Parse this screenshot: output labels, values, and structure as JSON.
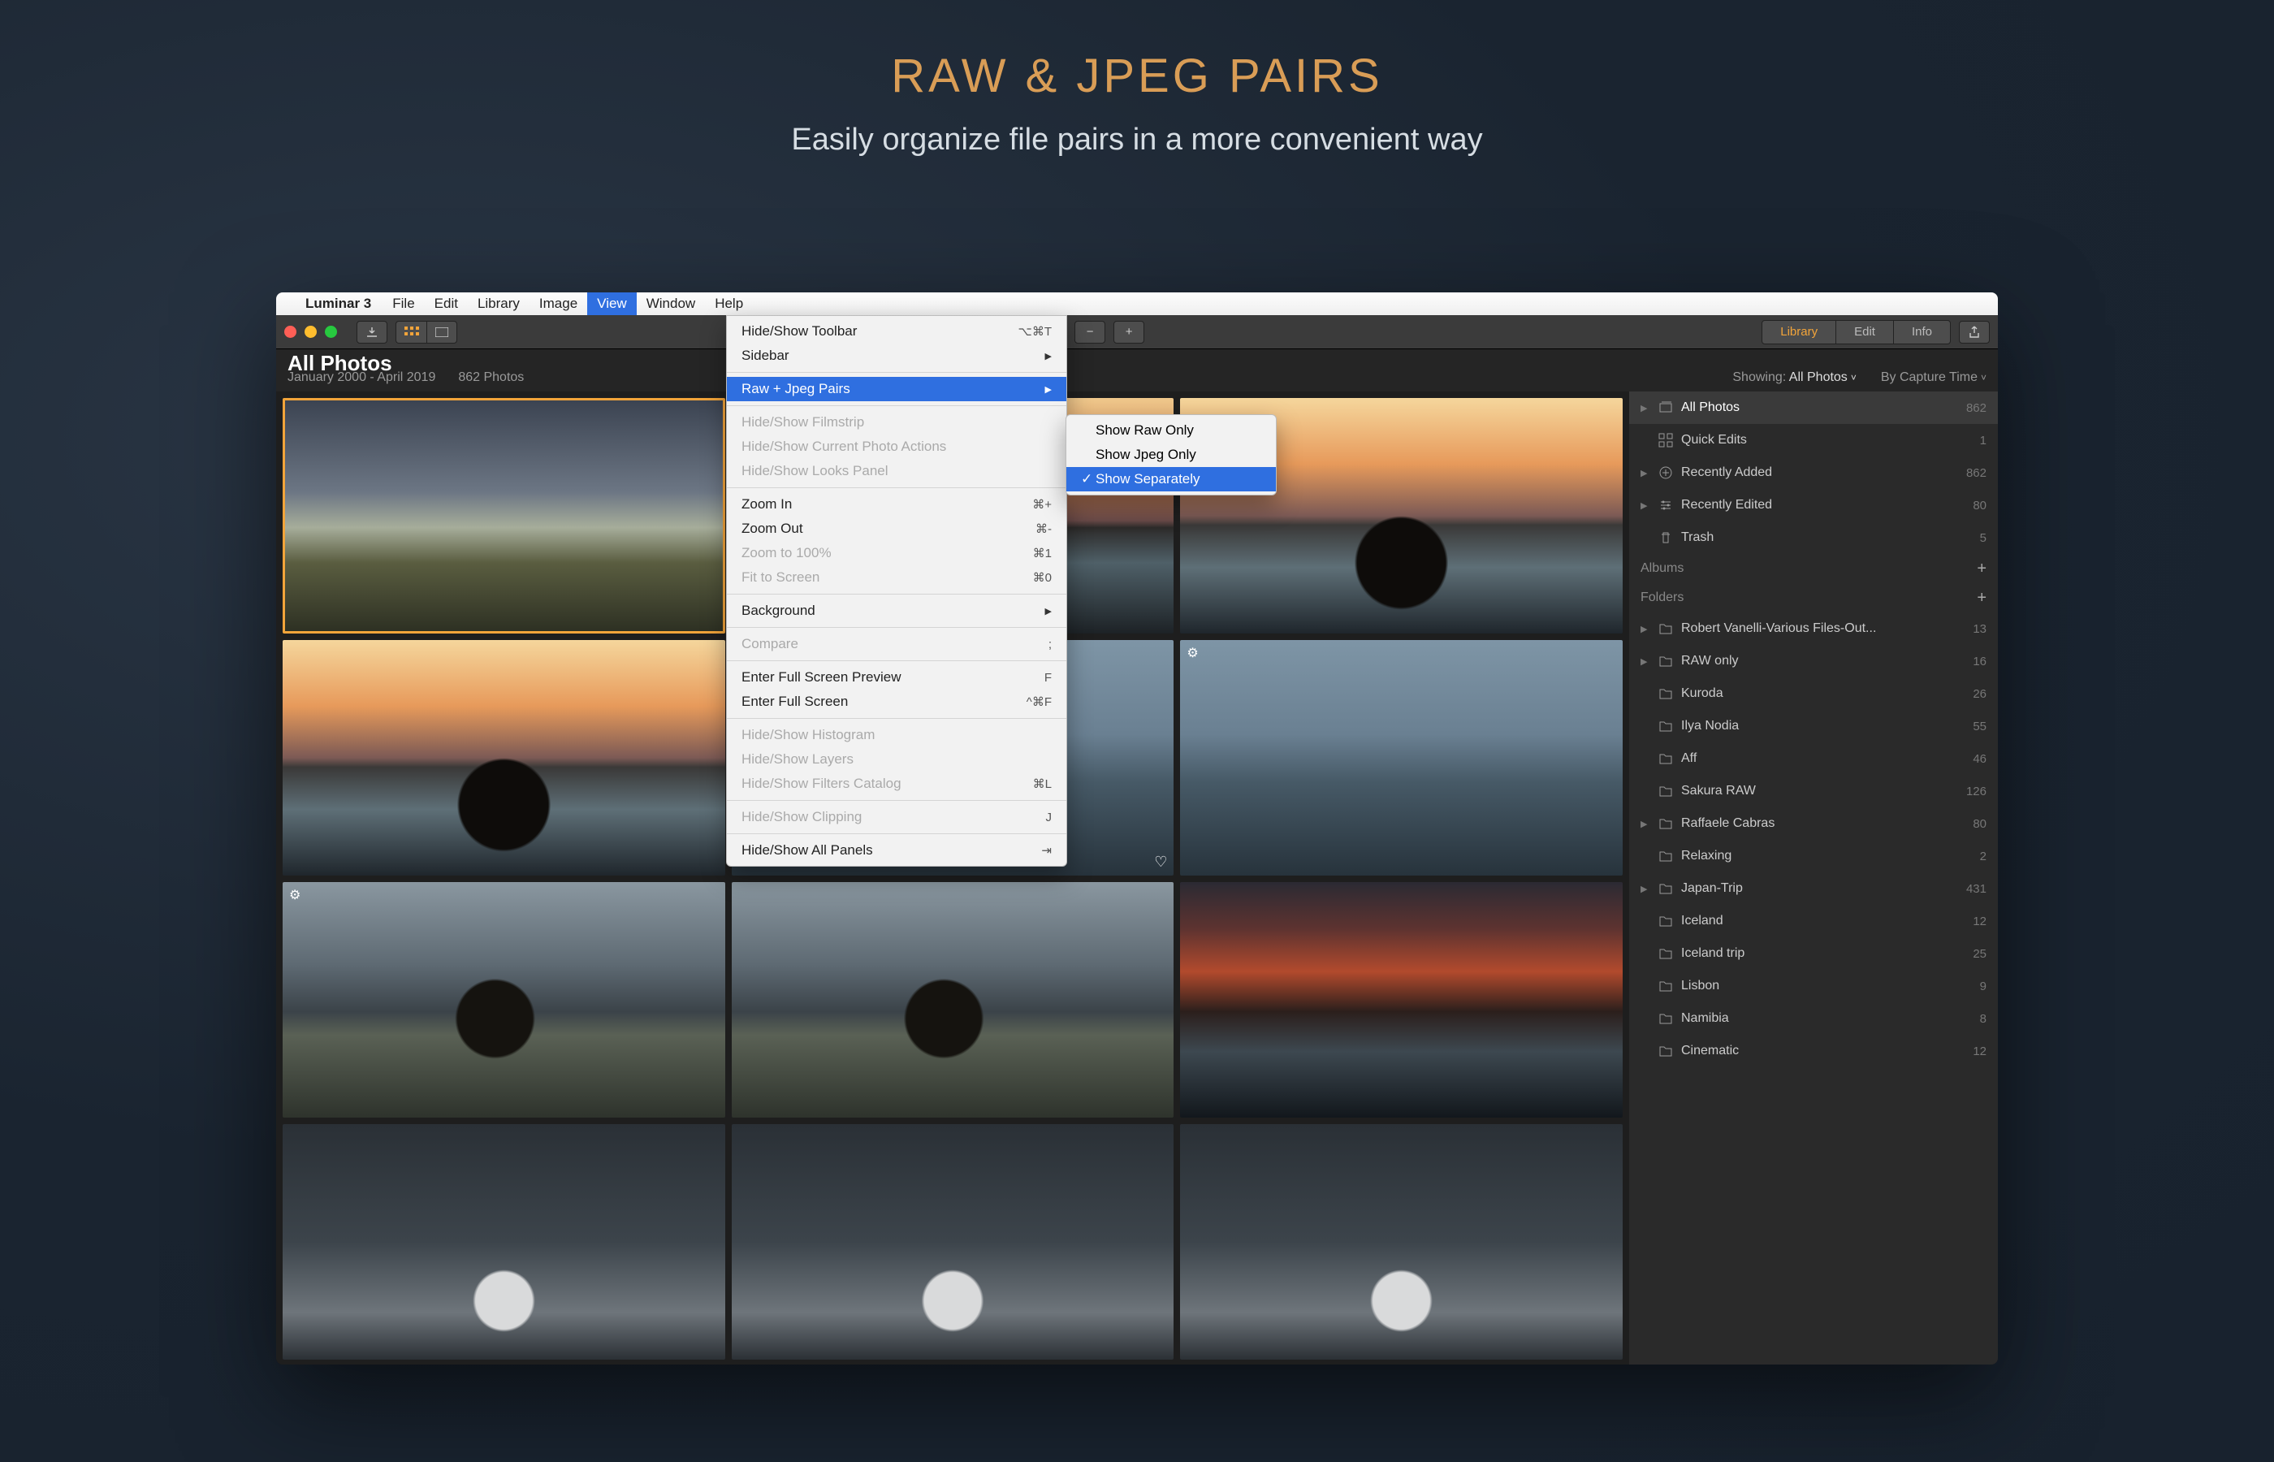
{
  "hero": {
    "title": "RAW & JPEG PAIRS",
    "subtitle": "Easily organize file pairs in a more convenient way"
  },
  "menubar": {
    "app": "Luminar 3",
    "items": [
      "File",
      "Edit",
      "Library",
      "Image",
      "View",
      "Window",
      "Help"
    ],
    "active": "View"
  },
  "toolbar": {
    "tabs": {
      "library": "Library",
      "edit": "Edit",
      "info": "Info",
      "active": "Library"
    }
  },
  "infobar": {
    "title": "All Photos",
    "date_range": "January 2000 - April 2019",
    "count": "862 Photos",
    "showing_label": "Showing:",
    "showing_value": "All Photos",
    "sort_value": "By Capture Time"
  },
  "view_menu": {
    "items": [
      {
        "label": "Hide/Show Toolbar",
        "shortcut": "⌥⌘T"
      },
      {
        "label": "Sidebar",
        "arrow": true
      },
      {
        "sep": true
      },
      {
        "label": "Raw + Jpeg Pairs",
        "arrow": true,
        "highlight": true
      },
      {
        "sep": true
      },
      {
        "label": "Hide/Show Filmstrip",
        "disabled": true
      },
      {
        "label": "Hide/Show Current Photo Actions",
        "disabled": true
      },
      {
        "label": "Hide/Show Looks Panel",
        "disabled": true
      },
      {
        "sep": true
      },
      {
        "label": "Zoom In",
        "shortcut": "⌘+"
      },
      {
        "label": "Zoom Out",
        "shortcut": "⌘-"
      },
      {
        "label": "Zoom to 100%",
        "shortcut": "⌘1",
        "disabled": true
      },
      {
        "label": "Fit to Screen",
        "shortcut": "⌘0",
        "disabled": true
      },
      {
        "sep": true
      },
      {
        "label": "Background",
        "arrow": true
      },
      {
        "sep": true
      },
      {
        "label": "Compare",
        "shortcut": ";",
        "disabled": true
      },
      {
        "sep": true
      },
      {
        "label": "Enter Full Screen Preview",
        "shortcut": "F"
      },
      {
        "label": "Enter Full Screen",
        "shortcut": "^⌘F"
      },
      {
        "sep": true
      },
      {
        "label": "Hide/Show Histogram",
        "disabled": true
      },
      {
        "label": "Hide/Show Layers",
        "disabled": true
      },
      {
        "label": "Hide/Show Filters Catalog",
        "shortcut": "⌘L",
        "disabled": true
      },
      {
        "sep": true
      },
      {
        "label": "Hide/Show Clipping",
        "shortcut": "J",
        "disabled": true
      },
      {
        "sep": true
      },
      {
        "label": "Hide/Show All Panels",
        "shortcut": "⇥"
      }
    ],
    "submenu": {
      "items": [
        {
          "label": "Show Raw Only"
        },
        {
          "label": "Show Jpeg Only"
        },
        {
          "label": "Show Separately",
          "checked": true,
          "highlight": true
        }
      ]
    }
  },
  "sidebar": {
    "shortcuts": [
      {
        "label": "All Photos",
        "count": "862",
        "icon": "stack",
        "disc": true,
        "active": true
      },
      {
        "label": "Quick Edits",
        "count": "1",
        "icon": "grid"
      },
      {
        "label": "Recently Added",
        "count": "862",
        "icon": "plus-circle",
        "disc": true
      },
      {
        "label": "Recently Edited",
        "count": "80",
        "icon": "sliders",
        "disc": true
      },
      {
        "label": "Trash",
        "count": "5",
        "icon": "trash"
      }
    ],
    "albums_label": "Albums",
    "folders_label": "Folders",
    "folders": [
      {
        "label": "Robert Vanelli-Various Files-Out...",
        "count": "13",
        "disc": true
      },
      {
        "label": "RAW only",
        "count": "16",
        "disc": true
      },
      {
        "label": "Kuroda",
        "count": "26"
      },
      {
        "label": "Ilya Nodia",
        "count": "55"
      },
      {
        "label": "Aff",
        "count": "46"
      },
      {
        "label": "Sakura RAW",
        "count": "126"
      },
      {
        "label": "Raffaele Cabras",
        "count": "80",
        "disc": true
      },
      {
        "label": "Relaxing",
        "count": "2"
      },
      {
        "label": "Japan-Trip",
        "count": "431",
        "disc": true
      },
      {
        "label": "Iceland",
        "count": "12"
      },
      {
        "label": "Iceland trip",
        "count": "25"
      },
      {
        "label": "Lisbon",
        "count": "9"
      },
      {
        "label": "Namibia",
        "count": "8"
      },
      {
        "label": "Cinematic",
        "count": "12"
      }
    ]
  }
}
